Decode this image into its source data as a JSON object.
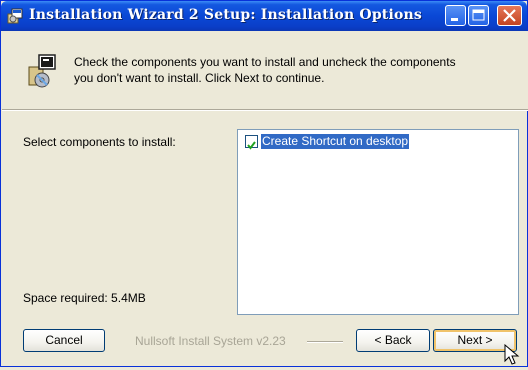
{
  "window": {
    "title": "Installation Wizard 2 Setup: Installation Options",
    "icons": {
      "app": "installer-icon",
      "minimize": "minimize-icon",
      "maximize": "maximize-icon",
      "close": "close-icon"
    }
  },
  "header": {
    "line1": "Check the components you want to install and uncheck the components",
    "line2": "you don't want to install. Click Next to continue.",
    "icon": "install-components-icon"
  },
  "body": {
    "select_label": "Select components to install:",
    "space_label": "Space required: 5.4MB",
    "components": [
      {
        "label": "Create Shortcut on desktop",
        "checked": true,
        "selected": true
      }
    ]
  },
  "footer": {
    "brand": "Nullsoft Install System v2.23",
    "cancel": "Cancel",
    "back": "< Back",
    "next": "Next >"
  },
  "colors": {
    "title_bar": "#0a48d6",
    "selection": "#316ac5",
    "dialog_bg": "#ece9d8"
  }
}
